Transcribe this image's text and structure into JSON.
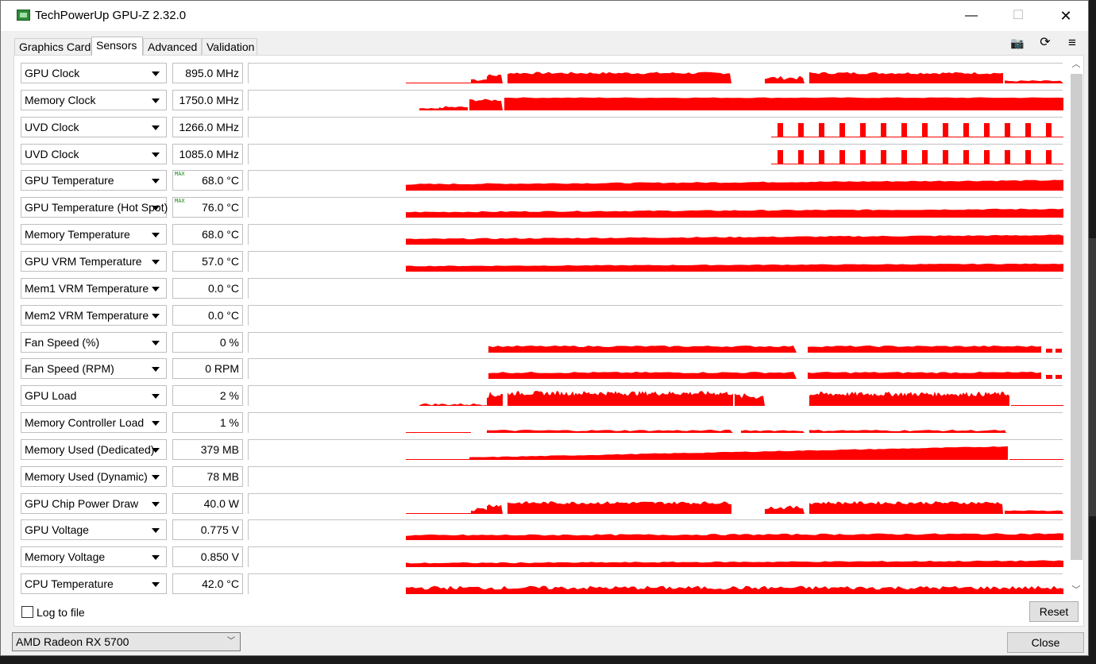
{
  "window": {
    "title": "TechPowerUp GPU-Z 2.32.0",
    "minimize_glyph": "—",
    "maximize_glyph": "☐",
    "close_glyph": "✕"
  },
  "tabs": [
    {
      "label": "Graphics Card",
      "active": false
    },
    {
      "label": "Sensors",
      "active": true
    },
    {
      "label": "Advanced",
      "active": false
    },
    {
      "label": "Validation",
      "active": false
    }
  ],
  "toolbar": {
    "icons": [
      "camera-icon",
      "refresh-icon",
      "hamburger-menu-icon"
    ],
    "camera_glyph": "📷",
    "refresh_glyph": "⟳",
    "menu_glyph": "≡"
  },
  "graph_color": "#ff0000",
  "sensors": [
    {
      "name": "GPU Clock",
      "value": "895.0 MHz",
      "max": false
    },
    {
      "name": "Memory Clock",
      "value": "1750.0 MHz",
      "max": false
    },
    {
      "name": "UVD Clock",
      "value": "1266.0 MHz",
      "max": false
    },
    {
      "name": "UVD Clock",
      "value": "1085.0 MHz",
      "max": false
    },
    {
      "name": "GPU Temperature",
      "value": "68.0 °C",
      "max": true
    },
    {
      "name": "GPU Temperature (Hot Spot)",
      "value": "76.0 °C",
      "max": true
    },
    {
      "name": "Memory Temperature",
      "value": "68.0 °C",
      "max": false
    },
    {
      "name": "GPU VRM Temperature",
      "value": "57.0 °C",
      "max": false
    },
    {
      "name": "Mem1 VRM Temperature",
      "value": "0.0 °C",
      "max": false
    },
    {
      "name": "Mem2 VRM Temperature",
      "value": "0.0 °C",
      "max": false
    },
    {
      "name": "Fan Speed (%)",
      "value": "0 %",
      "max": false
    },
    {
      "name": "Fan Speed (RPM)",
      "value": "0 RPM",
      "max": false
    },
    {
      "name": "GPU Load",
      "value": "2 %",
      "max": false
    },
    {
      "name": "Memory Controller Load",
      "value": "1 %",
      "max": false
    },
    {
      "name": "Memory Used (Dedicated)",
      "value": "379 MB",
      "max": false
    },
    {
      "name": "Memory Used (Dynamic)",
      "value": "78 MB",
      "max": false
    },
    {
      "name": "GPU Chip Power Draw",
      "value": "40.0 W",
      "max": false
    },
    {
      "name": "GPU Voltage",
      "value": "0.775 V",
      "max": false
    },
    {
      "name": "Memory Voltage",
      "value": "0.850 V",
      "max": false
    },
    {
      "name": "CPU Temperature",
      "value": "42.0 °C",
      "max": false
    }
  ],
  "max_label": "MAX",
  "footer": {
    "log_label": "Log to file",
    "log_checked": false,
    "reset_label": "Reset",
    "gpu_selected": "AMD Radeon RX 5700",
    "close_label": "Close"
  }
}
